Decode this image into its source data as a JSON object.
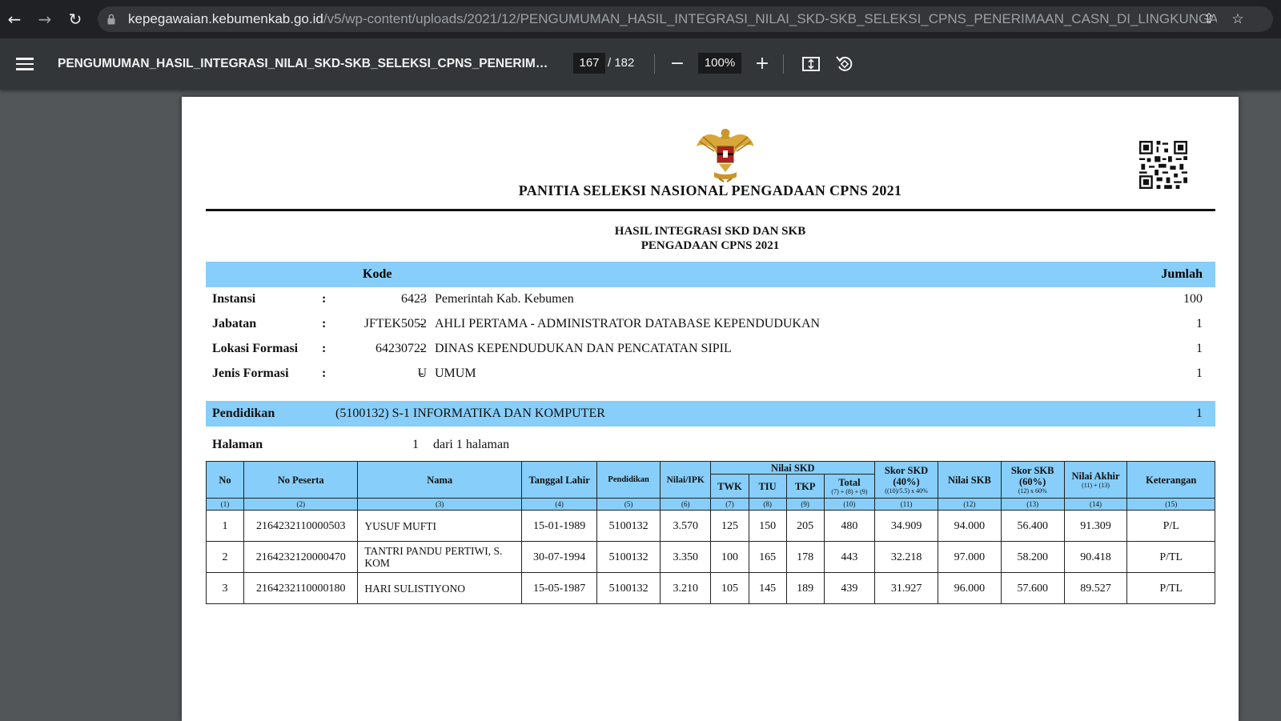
{
  "browser": {
    "url_host": "kepegawaian.kebumenkab.go.id",
    "url_path": "/v5/wp-content/uploads/2021/12/PENGUMUMAN_HASIL_INTEGRASI_NILAI_SKD-SKB_SELEKSI_CPNS_PENERIMAAN_CASN_DI_LINGKUNGAN_PEMERINTA..."
  },
  "toolbar": {
    "doc_title": "PENGUMUMAN_HASIL_INTEGRASI_NILAI_SKD-SKB_SELEKSI_CPNS_PENERIMAA...",
    "page_current": "167",
    "page_total": "/ 182",
    "zoom": "100%",
    "zoom_out": "−",
    "zoom_in": "+"
  },
  "document": {
    "heading": "PANITIA SELEKSI NASIONAL PENGADAAN CPNS 2021",
    "subheading1": "HASIL INTEGRASI SKD DAN SKB",
    "subheading2": "PENGADAAN CPNS 2021",
    "kode_label": "Kode",
    "jumlah_label": "Jumlah",
    "info": [
      {
        "label": "Instansi",
        "colon": ":",
        "code": "6423",
        "dash": "-",
        "value": "Pemerintah Kab. Kebumen",
        "count": "100"
      },
      {
        "label": "Jabatan",
        "colon": ":",
        "code": "JFTEK5052",
        "dash": "-",
        "value": "AHLI PERTAMA - ADMINISTRATOR DATABASE KEPENDUDUKAN",
        "count": "1"
      },
      {
        "label": "Lokasi Formasi",
        "colon": ":",
        "code": "64230722",
        "dash": "-",
        "value": "DINAS KEPENDUDUKAN DAN PENCATATAN SIPIL",
        "count": "1"
      },
      {
        "label": "Jenis Formasi",
        "colon": ":",
        "code": "U",
        "dash": "-",
        "value": "UMUM",
        "count": "1"
      }
    ],
    "pendidikan": {
      "label": "Pendidikan",
      "value": "(5100132) S-1 INFORMATIKA DAN KOMPUTER",
      "count": "1"
    },
    "halaman": {
      "label": "Halaman",
      "num": "1",
      "text": "dari 1 halaman"
    },
    "table": {
      "headers": {
        "no": "No",
        "no_peserta": "No Peserta",
        "nama": "Nama",
        "tanggal": "Tanggal Lahir",
        "pendidikan": "Pendidikan",
        "ipk": "Nilai/IPK",
        "nilai_skd": "Nilai SKD",
        "twk": "TWK",
        "tiu": "TIU",
        "tkp": "TKP",
        "total": "Total",
        "total_formula": "(7) + (8) + (9)",
        "skor_skd": "Skor SKD (40%)",
        "skor_skd_formula": "((10)/5.5) x 40%",
        "nilai_skb": "Nilai SKB",
        "skor_skb": "Skor SKB (60%)",
        "skor_skb_formula": "(12) x 60%",
        "nilai_akhir": "Nilai Akhir",
        "nilai_akhir_formula": "(11) + (13)",
        "keterangan": "Keterangan"
      },
      "col_numbers": [
        "(1)",
        "(2)",
        "(3)",
        "(4)",
        "(5)",
        "(6)",
        "(7)",
        "(8)",
        "(9)",
        "(10)",
        "(11)",
        "(12)",
        "(13)",
        "(14)",
        "(15)"
      ],
      "rows": [
        {
          "no": "1",
          "peserta": "2164232110000503",
          "nama": "YUSUF MUFTI",
          "tgl": "15-01-1989",
          "pend": "5100132",
          "ipk": "3.570",
          "twk": "125",
          "tiu": "150",
          "tkp": "205",
          "total": "480",
          "skor_skd": "34.909",
          "skb": "94.000",
          "skor_skb": "56.400",
          "akhir": "91.309",
          "ket": "P/L"
        },
        {
          "no": "2",
          "peserta": "2164232120000470",
          "nama": "TANTRI PANDU PERTIWI, S. KOM",
          "tgl": "30-07-1994",
          "pend": "5100132",
          "ipk": "3.350",
          "twk": "100",
          "tiu": "165",
          "tkp": "178",
          "total": "443",
          "skor_skd": "32.218",
          "skb": "97.000",
          "skor_skb": "58.200",
          "akhir": "90.418",
          "ket": "P/TL"
        },
        {
          "no": "3",
          "peserta": "2164232110000180",
          "nama": "HARI SULISTIYONO",
          "tgl": "15-05-1987",
          "pend": "5100132",
          "ipk": "3.210",
          "twk": "105",
          "tiu": "145",
          "tkp": "189",
          "total": "439",
          "skor_skd": "31.927",
          "skb": "96.000",
          "skor_skb": "57.600",
          "akhir": "89.527",
          "ket": "P/TL"
        }
      ]
    }
  },
  "colors": {
    "header_blue": "#87cefa",
    "viewer_bg": "#525659",
    "toolbar_bg": "#323639"
  }
}
